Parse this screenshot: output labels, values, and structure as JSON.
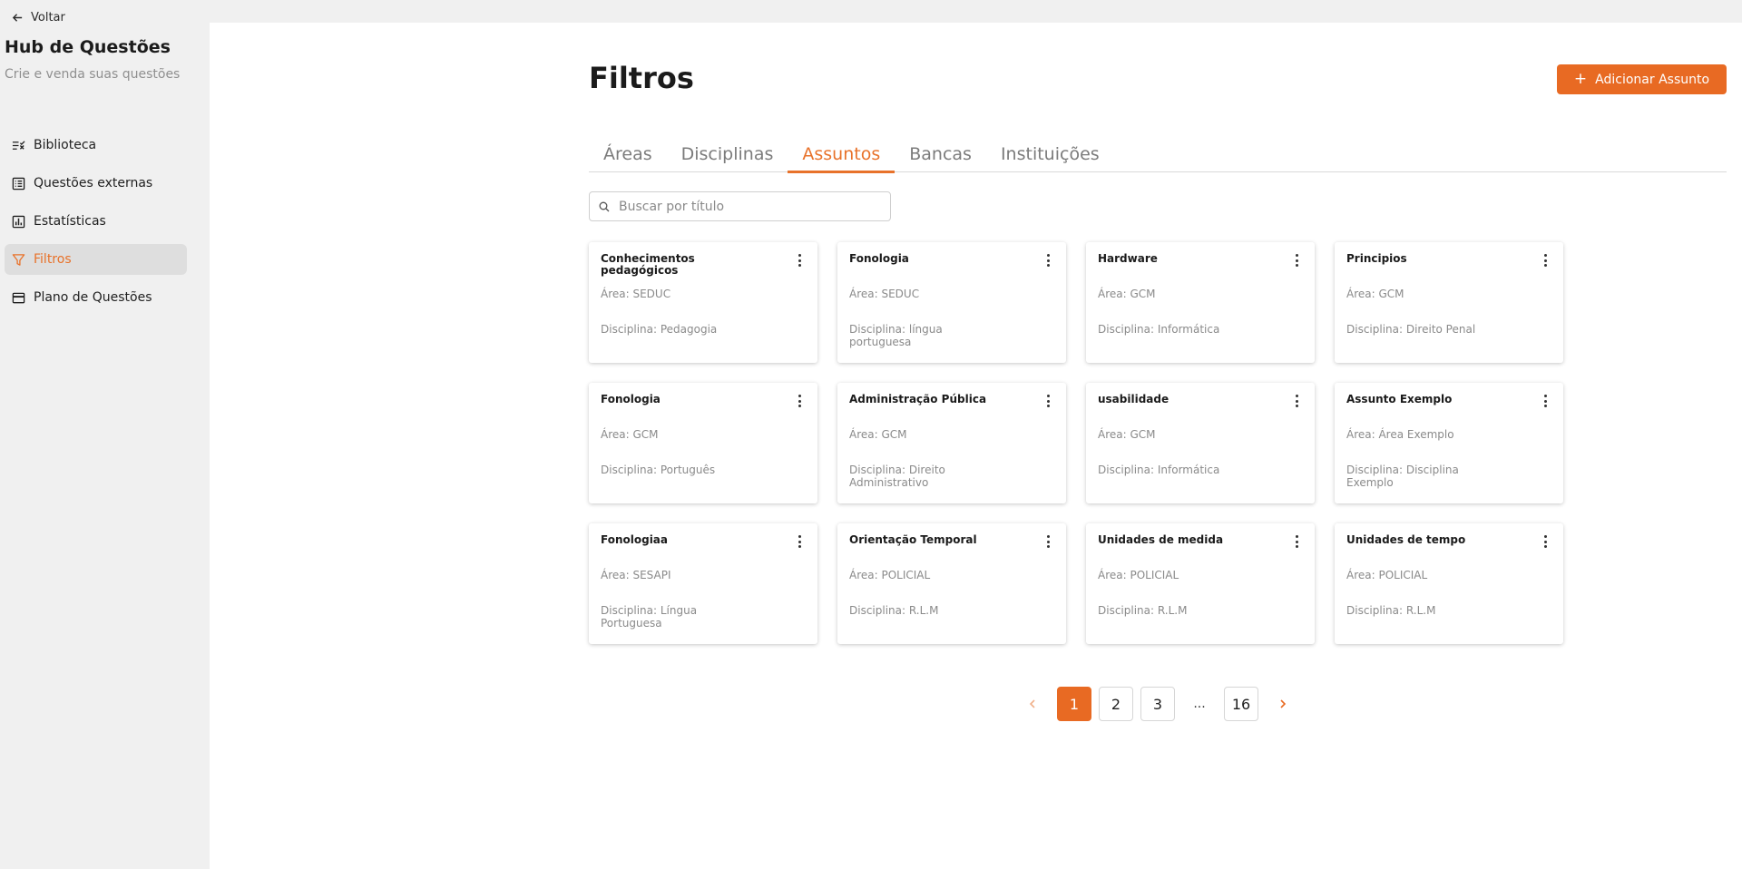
{
  "colors": {
    "accent": "#e86a23",
    "sidebar_bg": "#f0f0f0",
    "main_bg": "#ffffff"
  },
  "sidebar": {
    "back_label": "Voltar",
    "title": "Hub de Questões",
    "subtitle": "Crie e venda suas questões",
    "items": [
      {
        "label": "Biblioteca",
        "icon": "checklist-icon",
        "active": false
      },
      {
        "label": "Questões externas",
        "icon": "list-box-icon",
        "active": false
      },
      {
        "label": "Estatísticas",
        "icon": "bar-chart-icon",
        "active": false
      },
      {
        "label": "Filtros",
        "icon": "filter-icon",
        "active": true
      },
      {
        "label": "Plano de Questões",
        "icon": "card-icon",
        "active": false
      }
    ]
  },
  "main": {
    "title": "Filtros",
    "add_button_label": "Adicionar Assunto",
    "tabs": [
      {
        "label": "Áreas",
        "active": false
      },
      {
        "label": "Disciplinas",
        "active": false
      },
      {
        "label": "Assuntos",
        "active": true
      },
      {
        "label": "Bancas",
        "active": false
      },
      {
        "label": "Instituições",
        "active": false
      }
    ],
    "search": {
      "placeholder": "Buscar por título",
      "value": ""
    },
    "cards": [
      {
        "title": "Conhecimentos pedagógicos",
        "area": "Área: SEDUC",
        "disciplina": "Disciplina: Pedagogia"
      },
      {
        "title": "Fonologia",
        "area": "Área: SEDUC",
        "disciplina": "Disciplina: língua portuguesa"
      },
      {
        "title": "Hardware",
        "area": "Área: GCM",
        "disciplina": "Disciplina: Informática"
      },
      {
        "title": "Principios",
        "area": "Área: GCM",
        "disciplina": "Disciplina: Direito Penal"
      },
      {
        "title": "Fonologia",
        "area": "Área: GCM",
        "disciplina": "Disciplina: Português"
      },
      {
        "title": "Administração Pública",
        "area": "Área: GCM",
        "disciplina": "Disciplina: Direito Administrativo"
      },
      {
        "title": "usabilidade",
        "area": "Área: GCM",
        "disciplina": "Disciplina: Informática"
      },
      {
        "title": "Assunto Exemplo",
        "area": "Área: Área Exemplo",
        "disciplina": "Disciplina: Disciplina Exemplo"
      },
      {
        "title": "Fonologiaa",
        "area": "Área: SESAPI",
        "disciplina": "Disciplina: Língua Portuguesa"
      },
      {
        "title": "Orientação Temporal",
        "area": "Área: POLICIAL",
        "disciplina": "Disciplina: R.L.M"
      },
      {
        "title": "Unidades de medida",
        "area": "Área: POLICIAL",
        "disciplina": "Disciplina: R.L.M"
      },
      {
        "title": "Unidades de tempo",
        "area": "Área: POLICIAL",
        "disciplina": "Disciplina: R.L.M"
      }
    ],
    "pagination": {
      "pages": [
        "1",
        "2",
        "3"
      ],
      "ellipsis": "...",
      "last_page": "16",
      "current": "1"
    }
  }
}
